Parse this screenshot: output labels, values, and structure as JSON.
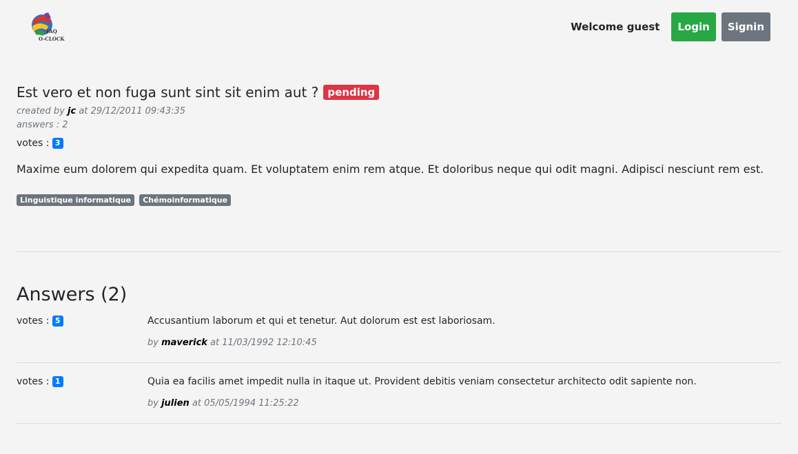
{
  "header": {
    "logo_text_line1": "FAQ",
    "logo_text_line2": "O-CLOCK",
    "welcome": "Welcome guest",
    "login_label": "Login",
    "signin_label": "Signin"
  },
  "question": {
    "title": "Est vero et non fuga sunt sint sit enim aut ?",
    "status": "pending",
    "created_prefix": "created by",
    "author": "jc",
    "at_prefix": "at",
    "date": "29/12/2011 09:43:35",
    "answers_count_label": "answers : 2",
    "votes_label": "votes :",
    "votes": "3",
    "body": "Maxime eum dolorem qui expedita quam. Et voluptatem enim rem atque. Et doloribus neque qui odit magni. Adipisci nesciunt rem est.",
    "tags": [
      "Linguistique informatique",
      "Chémoinformatique"
    ]
  },
  "answers_section": {
    "title": "Answers (2)",
    "items": [
      {
        "votes_label": "votes :",
        "votes": "5",
        "body": "Accusantium laborum et qui et tenetur. Aut dolorum est est laboriosam.",
        "by_prefix": "by",
        "author": "maverick",
        "at_prefix": "at",
        "date": "11/03/1992 12:10:45"
      },
      {
        "votes_label": "votes :",
        "votes": "1",
        "body": "Quia ea facilis amet impedit nulla in itaque ut. Provident debitis veniam consectetur architecto odit sapiente non.",
        "by_prefix": "by",
        "author": "julien",
        "at_prefix": "at",
        "date": "05/05/1994 11:25:22"
      }
    ]
  },
  "colors": {
    "login": "#28a745",
    "signin": "#6c757d",
    "pending": "#dc3545",
    "vote_badge": "#007bff",
    "tag": "#6c757d"
  }
}
